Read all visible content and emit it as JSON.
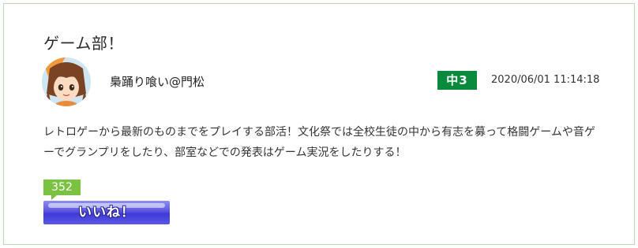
{
  "post": {
    "title": "ゲーム部！",
    "author": "梟踊り喰い@門松",
    "grade": "中3",
    "datetime": "2020/06/01 11:14:18",
    "description": "レトロゲーから最新のものまでをプレイする部活！文化祭では全校生徒の中から有志を募って格闘ゲームや音ゲーでグランプリをしたり、部室などでの発表はゲーム実況をしたりする！"
  },
  "like": {
    "count": "352",
    "button_label": "いいね！"
  },
  "colors": {
    "card_border": "#b9dcb5",
    "grade_badge": "#0a8a3c",
    "like_count_badge": "#7cc242",
    "like_button": "#5a55e0"
  },
  "icons": {
    "avatar": "girl-avatar-icon"
  }
}
